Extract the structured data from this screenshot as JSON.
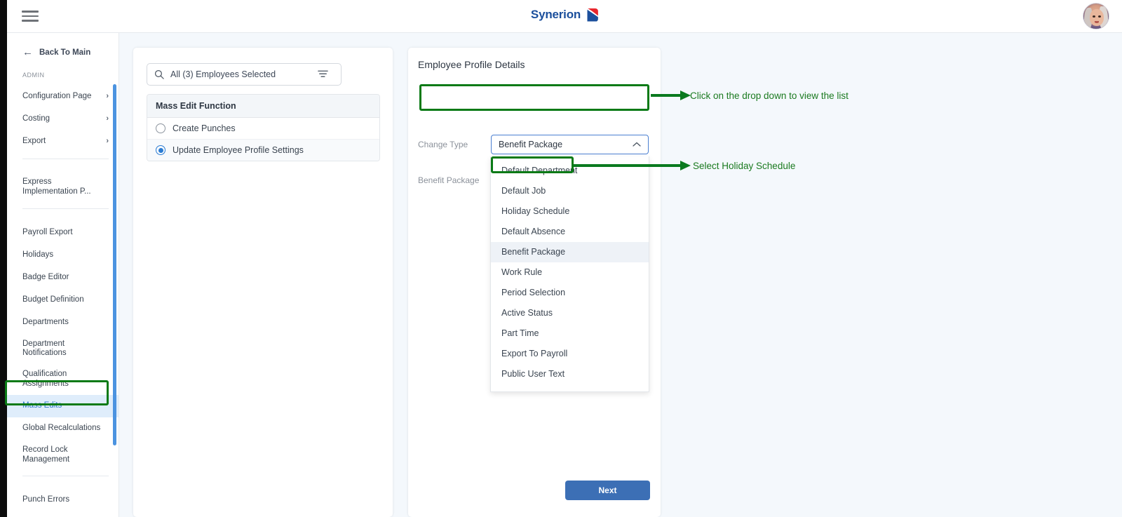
{
  "header": {
    "menu_icon": "hamburger-menu-icon",
    "brand_name": "Synerion",
    "avatar_alt": "user-avatar"
  },
  "sidebar": {
    "back_label": "Back To Main",
    "back_icon": "arrow-left-icon",
    "section_label": "ADMIN",
    "groups": [
      {
        "items": [
          {
            "label": "Configuration Page",
            "chevron": "›",
            "active": false
          },
          {
            "label": "Costing",
            "chevron": "›",
            "active": false
          },
          {
            "label": "Export",
            "chevron": "›",
            "active": false
          }
        ]
      },
      {
        "items": [
          {
            "label": "Express Implementation P...",
            "chevron": "",
            "active": false
          }
        ]
      },
      {
        "items": [
          {
            "label": "Payroll Export",
            "chevron": "",
            "active": false
          },
          {
            "label": "Holidays",
            "chevron": "",
            "active": false
          },
          {
            "label": "Badge Editor",
            "chevron": "",
            "active": false
          },
          {
            "label": "Budget Definition",
            "chevron": "",
            "active": false
          },
          {
            "label": "Departments",
            "chevron": "",
            "active": false
          },
          {
            "label": "Department Notifications",
            "chevron": "",
            "active": false
          },
          {
            "label": "Qualification Assignments",
            "chevron": "",
            "active": false
          },
          {
            "label": "Mass Edits",
            "chevron": "",
            "active": true
          },
          {
            "label": "Global Recalculations",
            "chevron": "",
            "active": false
          },
          {
            "label": "Record Lock Management",
            "chevron": "",
            "active": false
          }
        ]
      },
      {
        "items": [
          {
            "label": "Punch Errors",
            "chevron": "",
            "active": false
          }
        ]
      }
    ],
    "active_color": "#2f77c9",
    "active_bg": "#dfedfb",
    "scrollbar_color": "#4b93e0"
  },
  "employee_panel": {
    "search_value": "All (3) Employees Selected",
    "search_icon": "search-icon",
    "filter_icon": "filter-icon",
    "list_header": "Mass Edit Function",
    "options": [
      {
        "label": "Create Punches",
        "selected": false
      },
      {
        "label": "Update Employee Profile Settings",
        "selected": true
      }
    ]
  },
  "profile_panel": {
    "title": "Employee Profile Details",
    "change_type_label": "Change Type",
    "change_type_value": "Benefit Package",
    "chevron_icon": "chevron-up-icon",
    "benefit_package_label": "Benefit Package",
    "dropdown_options": [
      {
        "label": "Default Department",
        "selected": false
      },
      {
        "label": "Default Job",
        "selected": false
      },
      {
        "label": "Holiday Schedule",
        "selected": false
      },
      {
        "label": "Default Absence",
        "selected": false
      },
      {
        "label": "Benefit Package",
        "selected": true
      },
      {
        "label": "Work Rule",
        "selected": false
      },
      {
        "label": "Period Selection",
        "selected": false
      },
      {
        "label": "Active Status",
        "selected": false
      },
      {
        "label": "Part Time",
        "selected": false
      },
      {
        "label": "Export To Payroll",
        "selected": false
      },
      {
        "label": "Public User Text",
        "selected": false
      }
    ],
    "next_label": "Next",
    "next_color": "#3c6fb5"
  },
  "annotations": {
    "color": "#1a7a1f",
    "callout_1": "Click on the drop down to view the list",
    "callout_2": "Select Holiday Schedule"
  }
}
